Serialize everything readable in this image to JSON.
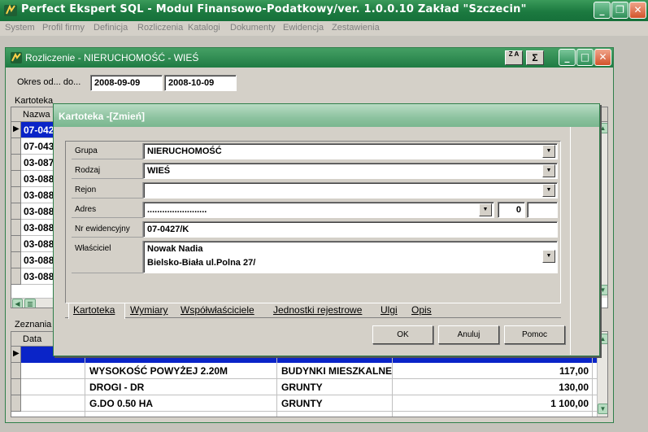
{
  "window": {
    "title": "Perfect Ekspert SQL - Modul Finansowo-Podatkowy/ver. 1.0.0.10 Zakład \"Szczecin\""
  },
  "menu": [
    "System",
    "Profil firmy",
    "Definicja",
    "Rozliczenia",
    "Katalogi",
    "Dokumenty",
    "Ewidencja",
    "Zestawienia"
  ],
  "child": {
    "title": "Rozliczenie - NIERUCHOMOŚĆ - WIEŚ",
    "period_label": "Okres od... do...",
    "date_from": "2008-09-09",
    "date_to": "2008-10-09",
    "sort_icon_label": "Z A",
    "sum_label": "Σ",
    "kartoteka_group": "Kartoteka",
    "kartoteka_col": "Nazwa",
    "kartoteka_rows": [
      "07-042",
      "07-043",
      "03-087",
      "03-088",
      "03-088",
      "03-088",
      "03-088",
      "03-088",
      "03-088",
      "03-088"
    ],
    "zeznania_group": "Zeznania",
    "zeznania_col": "Data",
    "zeznania_rows": [
      {
        "name": "WYSOKOŚĆ POWYŻEJ 2.20M",
        "type": "BUDYNKI MIESZKALNE",
        "amount": "117,00"
      },
      {
        "name": "DROGI - DR",
        "type": "GRUNTY",
        "amount": "130,00"
      },
      {
        "name": "G.DO 0.50 HA",
        "type": "GRUNTY",
        "amount": "1 100,00"
      }
    ]
  },
  "dialog": {
    "title": "Kartoteka -[Zmień]",
    "fields": {
      "grupa_label": "Grupa",
      "grupa_value": "NIERUCHOMOŚĆ",
      "rodzaj_label": "Rodzaj",
      "rodzaj_value": "WIEŚ",
      "rejon_label": "Rejon",
      "rejon_value": "",
      "adres_label": "Adres",
      "adres_value": "........................",
      "adres_number": "0",
      "nr_label": "Nr ewidencyjny",
      "nr_value": "07-0427/K",
      "wlasciciel_label": "Właściciel",
      "wlasciciel_line1": "Nowak Nadia",
      "wlasciciel_line2": "Bielsko-Biała ul.Polna 27/"
    },
    "tabs": [
      "Kartoteka",
      "Wymiary",
      "Współwłaściciele",
      "Jednostki rejestrowe",
      "Ulgi",
      "Opis"
    ],
    "buttons": {
      "ok": "OK",
      "cancel": "Anuluj",
      "help": "Pomoc"
    }
  }
}
